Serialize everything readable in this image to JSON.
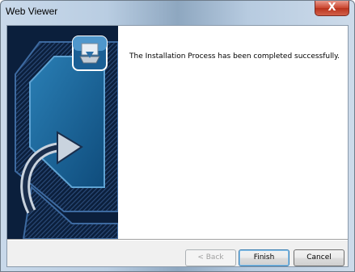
{
  "window": {
    "title": "Web Viewer",
    "close_label": "X"
  },
  "main": {
    "message": "The Installation Process has been completed successfully."
  },
  "buttons": {
    "back": "< Back",
    "finish": "Finish",
    "cancel": "Cancel"
  },
  "icons": {
    "banner": "install-banner-arrow",
    "installer": "installer-package-icon",
    "close": "close-icon"
  },
  "colors": {
    "banner_bg": "#0b1f3c",
    "close_button": "#c9452e"
  }
}
